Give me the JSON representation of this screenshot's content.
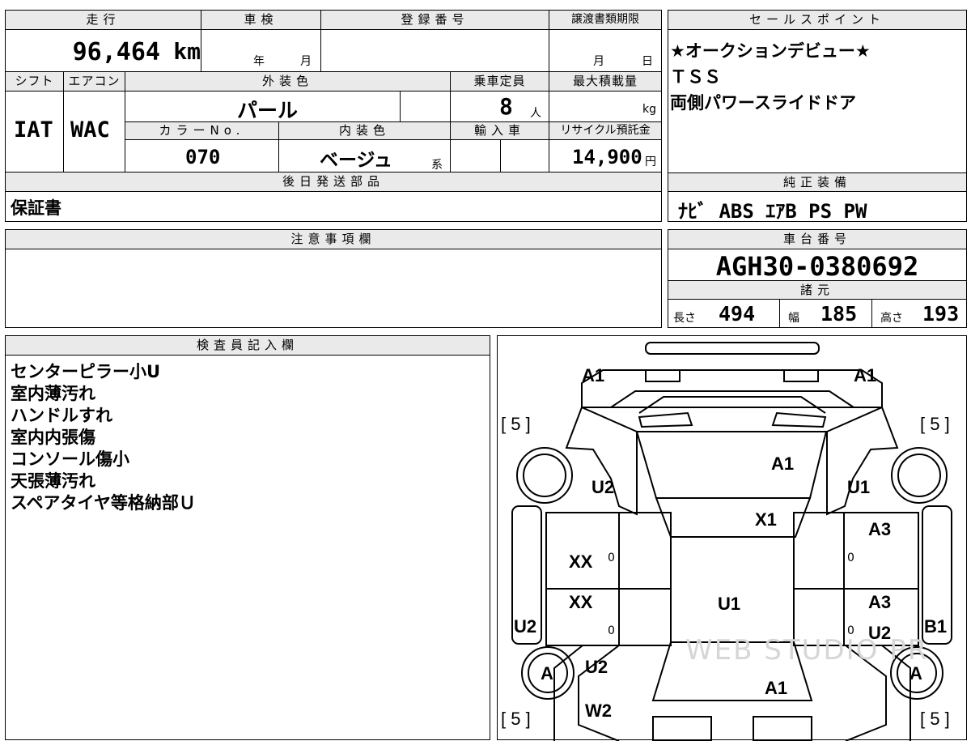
{
  "main_table": {
    "mileage": {
      "label": "走行",
      "value": "96,464",
      "unit": "km"
    },
    "inspection": {
      "label": "車検",
      "year": "年",
      "month": "月"
    },
    "registration": {
      "label": "登録番号"
    },
    "transfer_deadline": {
      "label": "譲渡書類期限",
      "month": "月",
      "day": "日"
    },
    "shift": {
      "label": "シフト",
      "value": "IAT"
    },
    "aircon": {
      "label": "エアコン",
      "value": "WAC"
    },
    "exterior": {
      "label": "外装色",
      "value": "パール"
    },
    "capacity": {
      "label": "乗車定員",
      "value": "8",
      "unit": "人"
    },
    "max_load": {
      "label": "最大積載量",
      "unit": "kg"
    },
    "color_no": {
      "label": "カラーNo.",
      "value": "070"
    },
    "interior": {
      "label": "内装色",
      "value": "ベージュ",
      "suffix": "系"
    },
    "import": {
      "label": "輸入車"
    },
    "recycle": {
      "label": "リサイクル預託金",
      "value": "14,900",
      "unit": "円"
    },
    "later_parts": {
      "label": "後日発送部品",
      "value": "保証書"
    }
  },
  "sales_points": {
    "label": "セールスポイント",
    "lines": [
      "★オークションデビュー★",
      "ＴＳＳ",
      "両側パワースライドドア"
    ]
  },
  "equipment": {
    "label": "純正装備",
    "value": "ﾅﾋﾞ ABS ｴｱB PS PW"
  },
  "notes": {
    "label": "注意事項欄"
  },
  "chassis": {
    "label": "車台番号",
    "value": "AGH30-0380692"
  },
  "specs": {
    "label": "諸元",
    "length": {
      "label": "長さ",
      "value": "494"
    },
    "width": {
      "label": "幅",
      "value": "185"
    },
    "height": {
      "label": "高さ",
      "value": "193"
    }
  },
  "inspector": {
    "label": "検査員記入欄",
    "lines": [
      "センターピラー小U",
      "室内薄汚れ",
      "ハンドルすれ",
      "室内内張傷",
      "コンソール傷小",
      "天張薄汚れ",
      "スペアタイヤ等格納部Ｕ"
    ]
  },
  "diagram": {
    "labels": {
      "front_left": "A1",
      "front_right": "A1",
      "tire_fl": "[ 5 ]",
      "tire_fr": "[ 5 ]",
      "tire_rl": "[ 5 ]",
      "tire_rr": "[ 5 ]",
      "hood": "A1",
      "fender_fl": "U2",
      "fender_fr": "U1",
      "windshield": "X1",
      "door_fl": "XX",
      "door_rl": "XX",
      "door_fr": "A3",
      "door_rr": "A3",
      "roof": "U1",
      "side_left": "U2",
      "side_right": "B1",
      "rear_right": "U2",
      "wheel_l": "A",
      "wheel_r": "A",
      "quarter_l": "U2",
      "trunk": "A1",
      "rear_bumper": "W2",
      "zero_1": "0",
      "zero_2": "0",
      "zero_3": "0",
      "zero_4": "0"
    },
    "watermark": "WEB STUDIO PR"
  }
}
